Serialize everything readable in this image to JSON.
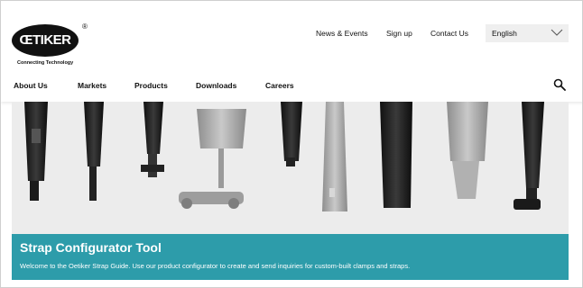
{
  "brand": {
    "logo_text": "ŒTIKER",
    "registered": "®",
    "tagline": "Connecting Technology"
  },
  "top_nav": {
    "items": [
      {
        "label": "News & Events"
      },
      {
        "label": "Sign up"
      },
      {
        "label": "Contact Us"
      }
    ],
    "language": {
      "selected": "English"
    }
  },
  "main_nav": {
    "items": [
      {
        "label": "About Us"
      },
      {
        "label": "Markets"
      },
      {
        "label": "Products"
      },
      {
        "label": "Downloads"
      },
      {
        "label": "Careers"
      }
    ]
  },
  "hero": {
    "title": "Strap Configurator Tool",
    "subtitle": "Welcome to the Oetiker Strap Guide. Use our product configurator to create and send inquiries for custom-built clamps and straps."
  },
  "colors": {
    "accent": "#2d9caa",
    "text": "#111111"
  },
  "icons": {
    "search": "search-icon",
    "dropdown": "chevron-down-icon"
  }
}
